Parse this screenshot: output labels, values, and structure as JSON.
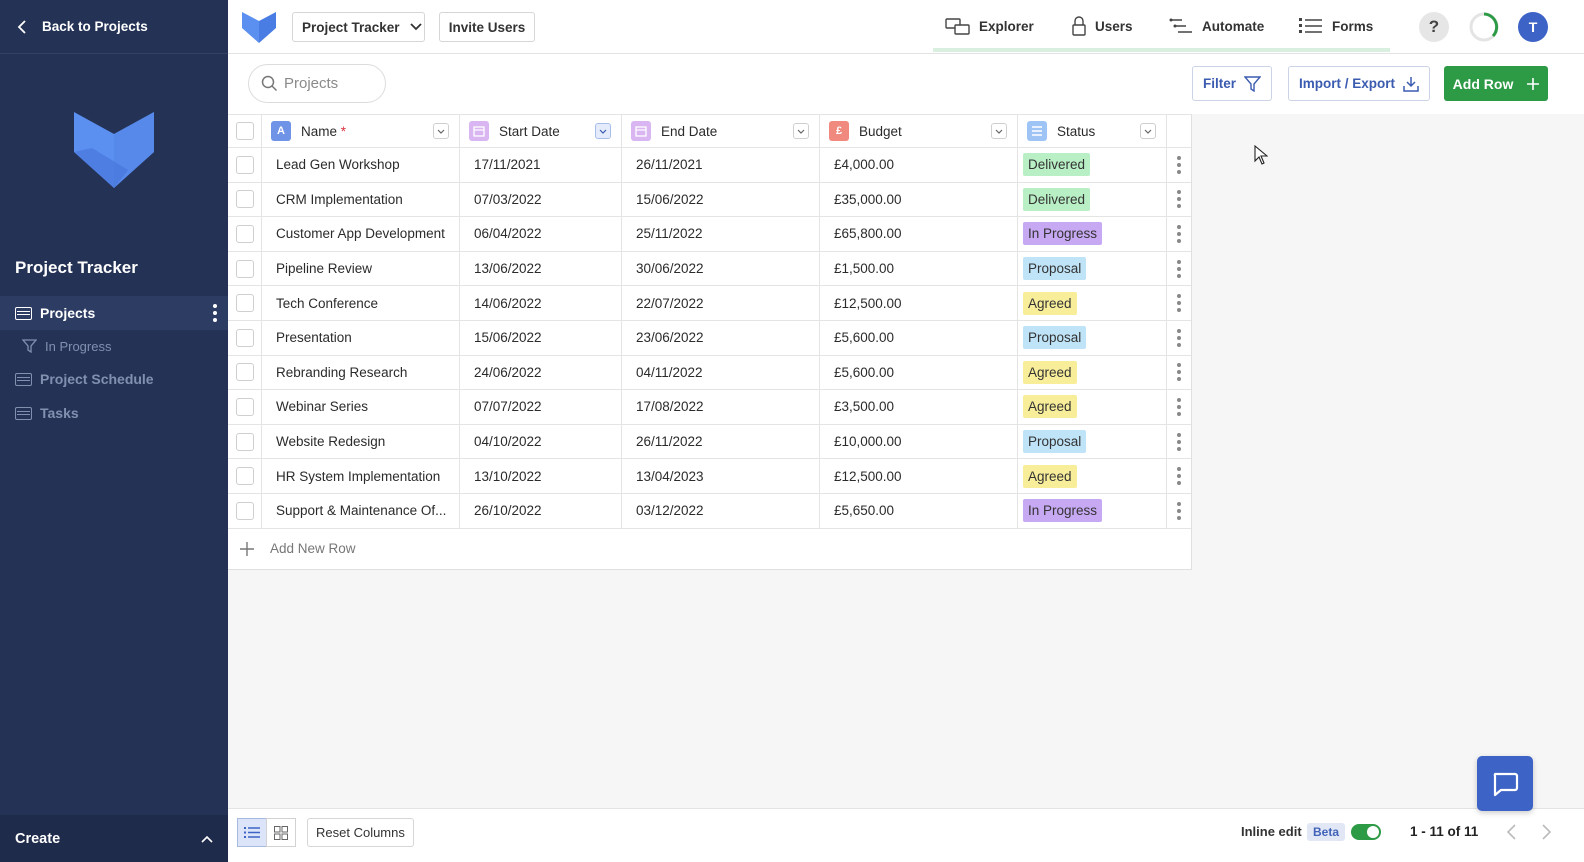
{
  "sidebar": {
    "back_label": "Back to Projects",
    "app_name": "Project Tracker",
    "nav": [
      {
        "label": "Projects"
      },
      {
        "label": "In Progress"
      },
      {
        "label": "Project Schedule"
      },
      {
        "label": "Tasks"
      }
    ],
    "create_label": "Create"
  },
  "topbar": {
    "app_select": "Project Tracker",
    "invite_label": "Invite Users",
    "nav": {
      "explorer": "Explorer",
      "users": "Users",
      "automate": "Automate",
      "forms": "Forms"
    },
    "help": "?",
    "avatar_initial": "T"
  },
  "toolbar": {
    "search_placeholder": "Projects",
    "filter_label": "Filter",
    "import_export_label": "Import / Export",
    "add_row_label": "Add Row"
  },
  "columns": {
    "name": "Name",
    "required_mark": "*",
    "start": "Start Date",
    "end": "End Date",
    "budget": "Budget",
    "budget_icon": "£",
    "name_icon": "A",
    "status": "Status"
  },
  "rows": [
    {
      "name": "Lead Gen Workshop",
      "start": "17/11/2021",
      "end": "26/11/2021",
      "budget": "£4,000.00",
      "status": "Delivered"
    },
    {
      "name": "CRM Implementation",
      "start": "07/03/2022",
      "end": "15/06/2022",
      "budget": "£35,000.00",
      "status": "Delivered"
    },
    {
      "name": "Customer App Development",
      "start": "06/04/2022",
      "end": "25/11/2022",
      "budget": "£65,800.00",
      "status": "In Progress"
    },
    {
      "name": "Pipeline Review",
      "start": "13/06/2022",
      "end": "30/06/2022",
      "budget": "£1,500.00",
      "status": "Proposal"
    },
    {
      "name": "Tech Conference",
      "start": "14/06/2022",
      "end": "22/07/2022",
      "budget": "£12,500.00",
      "status": "Agreed"
    },
    {
      "name": "Presentation",
      "start": "15/06/2022",
      "end": "23/06/2022",
      "budget": "£5,600.00",
      "status": "Proposal"
    },
    {
      "name": "Rebranding Research",
      "start": "24/06/2022",
      "end": "04/11/2022",
      "budget": "£5,600.00",
      "status": "Agreed"
    },
    {
      "name": "Webinar Series",
      "start": "07/07/2022",
      "end": "17/08/2022",
      "budget": "£3,500.00",
      "status": "Agreed"
    },
    {
      "name": "Website Redesign",
      "start": "04/10/2022",
      "end": "26/11/2022",
      "budget": "£10,000.00",
      "status": "Proposal"
    },
    {
      "name": "HR System Implementation",
      "start": "13/10/2022",
      "end": "13/04/2023",
      "budget": "£12,500.00",
      "status": "Agreed"
    },
    {
      "name": "Support & Maintenance Of...",
      "start": "26/10/2022",
      "end": "03/12/2022",
      "budget": "£5,650.00",
      "status": "In Progress"
    }
  ],
  "status_colors": {
    "Delivered": "#b9efc5",
    "In Progress": "#c7a8f2",
    "Proposal": "#bfe3f7",
    "Agreed": "#f8ee9a"
  },
  "add_new_row_label": "Add New Row",
  "footer": {
    "reset_label": "Reset Columns",
    "inline_edit_label": "Inline edit",
    "beta_label": "Beta",
    "inline_edit_on": true,
    "pagination": "1 - 11 of 11"
  },
  "colors": {
    "sidebar": "#243255",
    "accent": "#3d63c6",
    "success": "#2d9a46"
  }
}
